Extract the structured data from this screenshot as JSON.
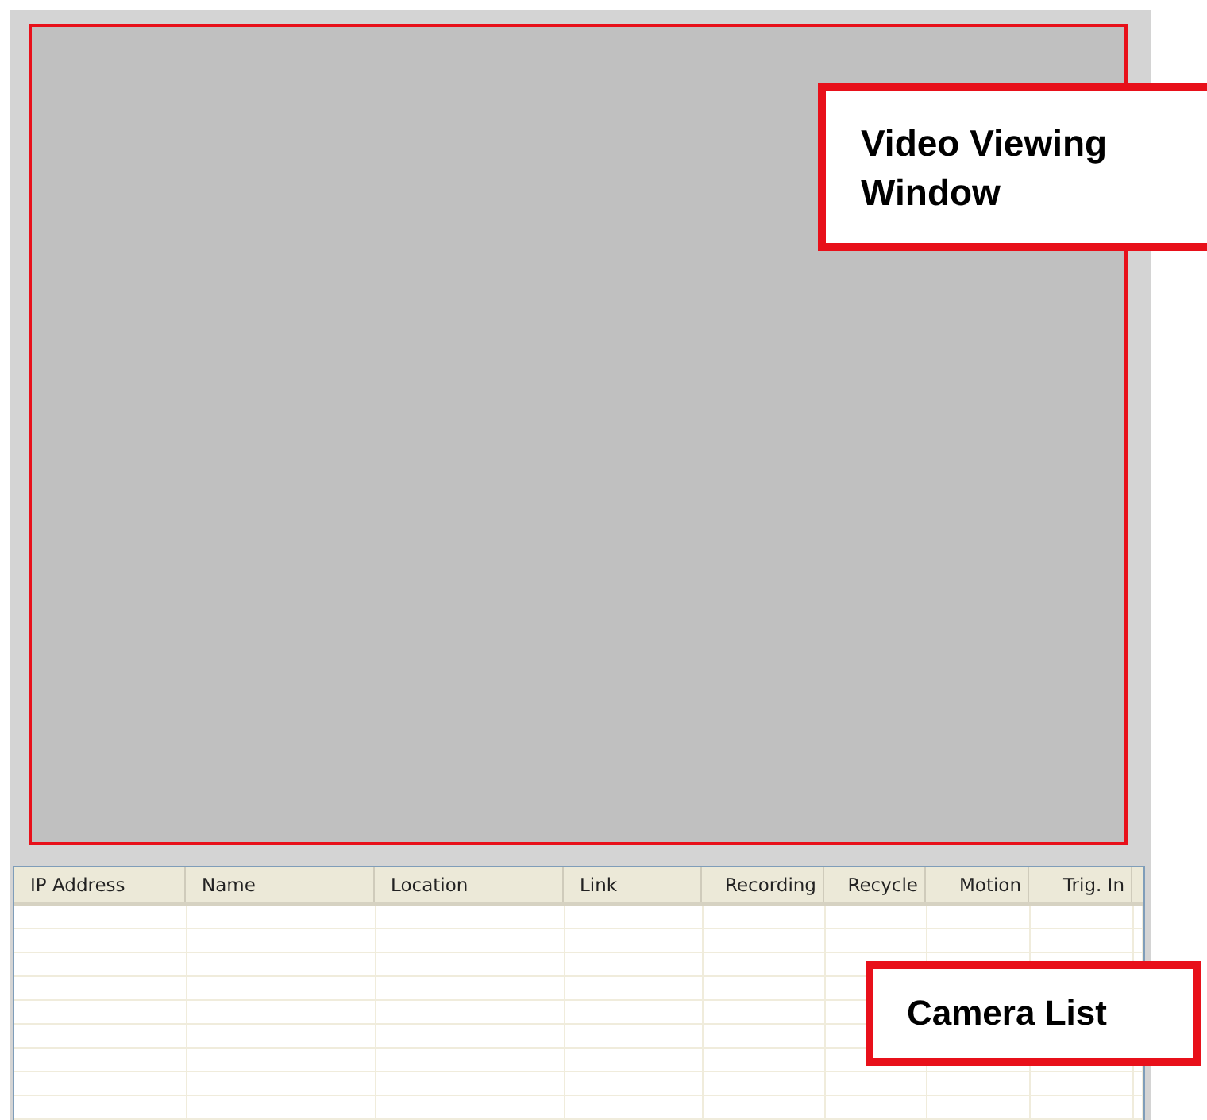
{
  "video_window": {
    "callout": "Video Viewing Window"
  },
  "camera_list": {
    "columns": [
      "IP Address",
      "Name",
      "Location",
      "Link",
      "Recording",
      "Recycle",
      "Motion",
      "Trig. In"
    ],
    "callout": "Camera List"
  }
}
